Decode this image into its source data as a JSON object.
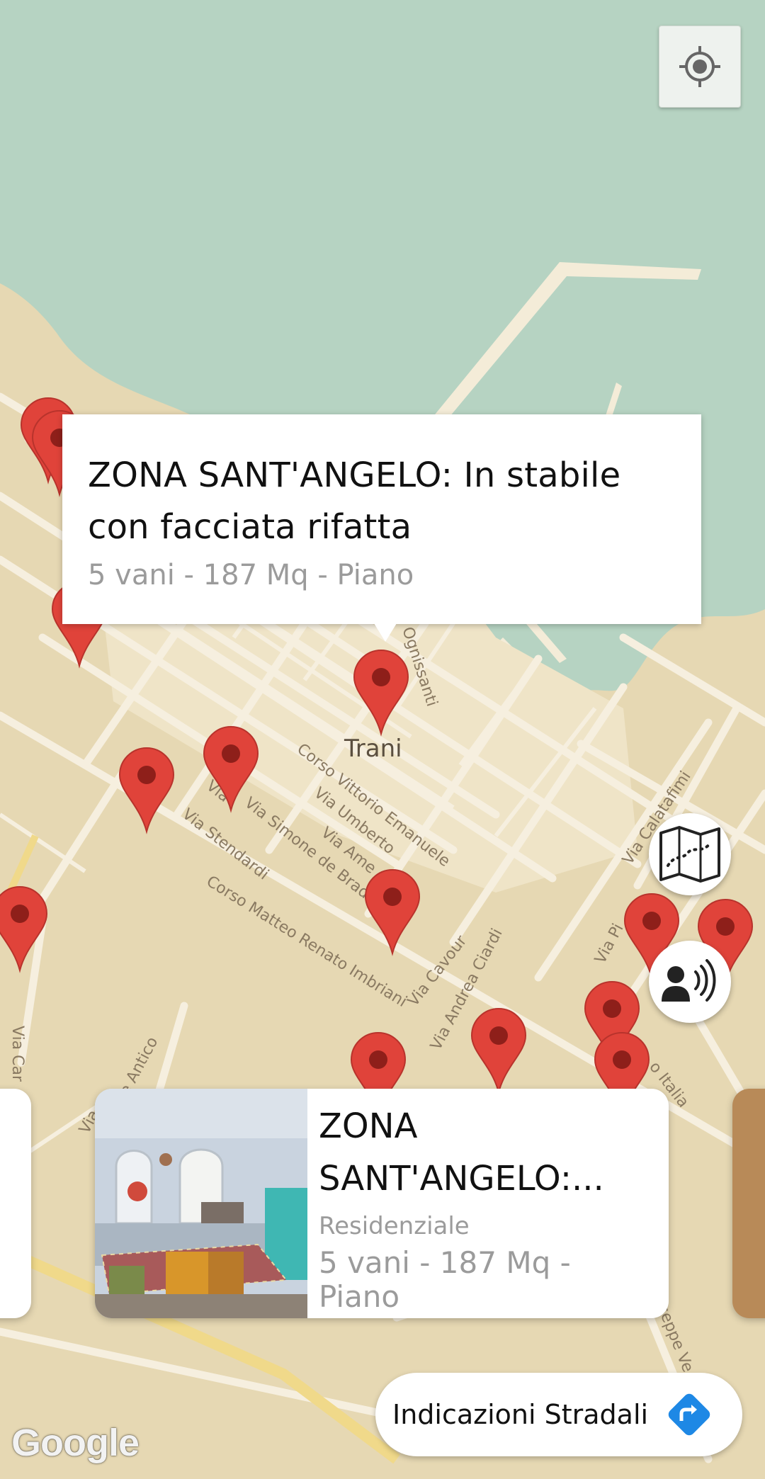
{
  "map": {
    "town_label": "Trani",
    "streets": [
      "Ognissanti",
      "Corso Vittorio Emanuele",
      "Via Umberto",
      "Via Ame",
      "Via Simone de Brado",
      "Via Stendardi",
      "Via",
      "Corso Matteo Renato Imbriani",
      "Via Cavour",
      "Via Andrea Ciardi",
      "Via Calatafimi",
      "Via Pi",
      "Via Car",
      "Via",
      "onte Antico",
      "o Italia",
      "iseppe Ve"
    ],
    "water_color": "#b6d3c2",
    "land_color": "#e6d8b3",
    "road_color": "#f6efdf",
    "marker_color": "#e0433a"
  },
  "info_window": {
    "title": "ZONA SANT'ANGELO: In stabile con facciata rifatta",
    "subtitle": "5 vani - 187 Mq - Piano"
  },
  "carousel": {
    "card": {
      "title": "ZONA SANT'ANGELO:...",
      "type": "Residenziale",
      "description": "5 vani - 187 Mq - Piano"
    }
  },
  "buttons": {
    "locate_icon": "my-location-icon",
    "map_icon": "folded-map-icon",
    "voice_icon": "voice-guidance-icon",
    "directions_label": "Indicazioni Stradali",
    "directions_icon": "directions-arrow-icon"
  },
  "attribution": "Google"
}
